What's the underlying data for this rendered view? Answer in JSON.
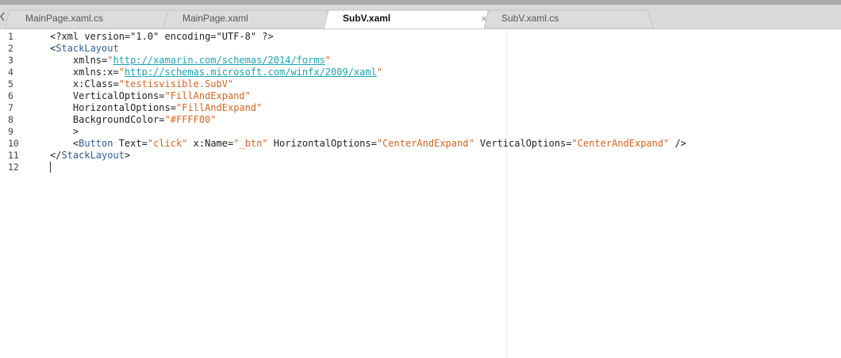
{
  "tabs": [
    {
      "label": "MainPage.xaml.cs",
      "active": false
    },
    {
      "label": "MainPage.xaml",
      "active": false
    },
    {
      "label": "SubV.xaml",
      "active": true,
      "close": "×"
    },
    {
      "label": "SubV.xaml.cs",
      "active": false
    }
  ],
  "editor": {
    "line_numbers": [
      "1",
      "2",
      "3",
      "4",
      "5",
      "6",
      "7",
      "8",
      "9",
      "10",
      "11",
      "12"
    ],
    "lines": [
      {
        "parts": [
          {
            "t": "<?xml version=\"1.0\" encoding=\"UTF-8\" ?>",
            "c": "plain"
          }
        ]
      },
      {
        "parts": [
          {
            "t": "<",
            "c": "plain"
          },
          {
            "t": "StackLayout",
            "c": "tag"
          }
        ]
      },
      {
        "parts": [
          {
            "t": "    xmlns=",
            "c": "plain"
          },
          {
            "t": "\"",
            "c": "str"
          },
          {
            "t": "http://xamarin.com/schemas/2014/forms",
            "c": "url"
          },
          {
            "t": "\"",
            "c": "str"
          }
        ]
      },
      {
        "parts": [
          {
            "t": "    xmlns:x=",
            "c": "plain"
          },
          {
            "t": "\"",
            "c": "str"
          },
          {
            "t": "http://schemas.microsoft.com/winfx/2009/xaml",
            "c": "url"
          },
          {
            "t": "\"",
            "c": "str"
          }
        ]
      },
      {
        "parts": [
          {
            "t": "    x:Class=",
            "c": "plain"
          },
          {
            "t": "\"testisvisible.SubV\"",
            "c": "str"
          }
        ]
      },
      {
        "parts": [
          {
            "t": "    VerticalOptions=",
            "c": "plain"
          },
          {
            "t": "\"FillAndExpand\"",
            "c": "str"
          }
        ]
      },
      {
        "parts": [
          {
            "t": "    HorizontalOptions=",
            "c": "plain"
          },
          {
            "t": "\"FillAndExpand\"",
            "c": "str"
          }
        ]
      },
      {
        "parts": [
          {
            "t": "    BackgroundColor=",
            "c": "plain"
          },
          {
            "t": "\"#FFFF00\"",
            "c": "str"
          }
        ]
      },
      {
        "parts": [
          {
            "t": "    >",
            "c": "plain"
          }
        ]
      },
      {
        "parts": [
          {
            "t": "    <",
            "c": "plain"
          },
          {
            "t": "Button",
            "c": "tag"
          },
          {
            "t": " Text=",
            "c": "plain"
          },
          {
            "t": "\"click\"",
            "c": "str"
          },
          {
            "t": " x:Name=",
            "c": "plain"
          },
          {
            "t": "\"_btn\"",
            "c": "str"
          },
          {
            "t": " HorizontalOptions=",
            "c": "plain"
          },
          {
            "t": "\"CenterAndExpand\"",
            "c": "str"
          },
          {
            "t": " VerticalOptions=",
            "c": "plain"
          },
          {
            "t": "\"CenterAndExpand\"",
            "c": "str"
          },
          {
            "t": " />",
            "c": "plain"
          }
        ]
      },
      {
        "parts": [
          {
            "t": "</",
            "c": "plain"
          },
          {
            "t": "StackLayout",
            "c": "tag"
          },
          {
            "t": ">",
            "c": "plain"
          }
        ]
      },
      {
        "parts": []
      }
    ]
  },
  "colors": {
    "tag": "#2f5f96",
    "string": "#d9641f",
    "url": "#19a6b5",
    "tabbar": "#d9d9d9",
    "active_tab": "#ffffff"
  },
  "icons": {
    "scroll_left": "chevron-left-icon",
    "close": "close-icon"
  }
}
